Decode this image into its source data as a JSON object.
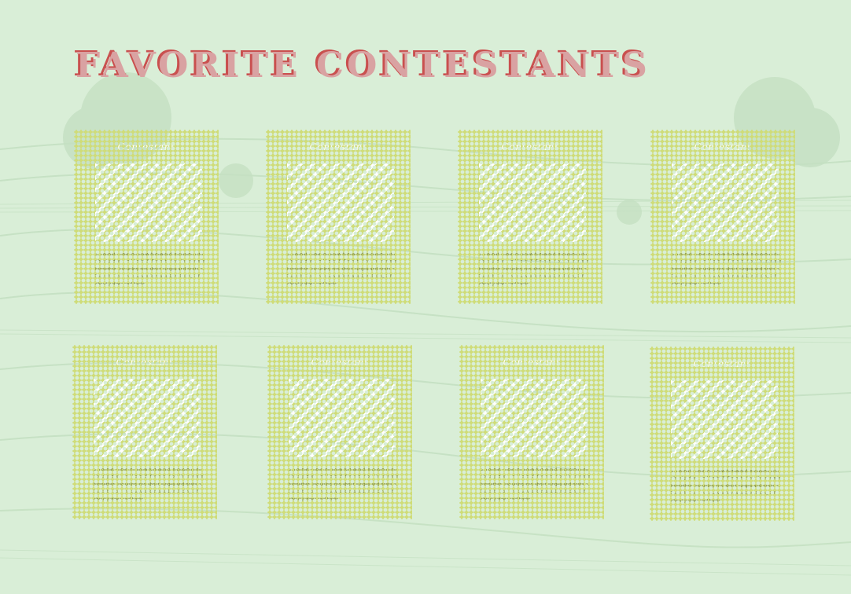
{
  "page": {
    "title": "FAVORITE CONTESTANTS"
  },
  "colors": {
    "background": "#d9eed7",
    "card": "#cfdc79",
    "title_fill": "#d9a2a2",
    "title_shadow": "#c9504f",
    "pattern_stripe": "#ffffff"
  },
  "cards": [
    {
      "label": "Contestant",
      "text": "3. Format - how the show formatted, including info about judges and hosts 3. Format - how the show is formatted, including info about judges and hosts 3. Format - how the show is formatted, including info about judges and hosts"
    },
    {
      "label": "Contestant",
      "text": "3. Format - how the show formatted, including info about judges and hosts 3. Format - how the show is formatted, including info about judges and hosts 3. Format - how the show is formatted, including info about judges and hosts"
    },
    {
      "label": "Contestant",
      "text": "3. Format - how the show formatted, including info about judges and hosts 3. Format - how the show is formatted, including info about judges and hosts 3. Format - how the show is formatted, including info about judges and hosts"
    },
    {
      "label": "Contestant",
      "text": "3. Format - how the show formatted, including info about judges and hosts 3. Format - how the show is formatted, including info about judges and hosts 3. Format - how the show is formatted, including info about judges and hosts"
    },
    {
      "label": "Contestant",
      "text": "3. Format - how the show formatted, including info about judges and hosts 3. Format - how the show is formatted, including info about judges and hosts 3. Format - how the show is formatted, including info about judges and hosts"
    },
    {
      "label": "Contestant",
      "text": "3. Format - how the show formatted, including info about judges and hosts 3. Format - how the show is formatted, including info about judges and hosts 3. Format - how the show is formatted, including info about judges and hosts"
    },
    {
      "label": "Contestant",
      "text": "3. Format - how the show formatted, including info about judges and hosts 3. Format - how the show is formatted, including info about judges and hosts 3. Format - how the show is formatted, including info about judges and hosts"
    },
    {
      "label": "Contestant",
      "text": "3. Format - how the show formatted, including info about judges and hosts 3. Format - how the show is formatted, including info about judges and hosts 3. Format - how the show is formatted, including info about judges and hosts"
    }
  ]
}
